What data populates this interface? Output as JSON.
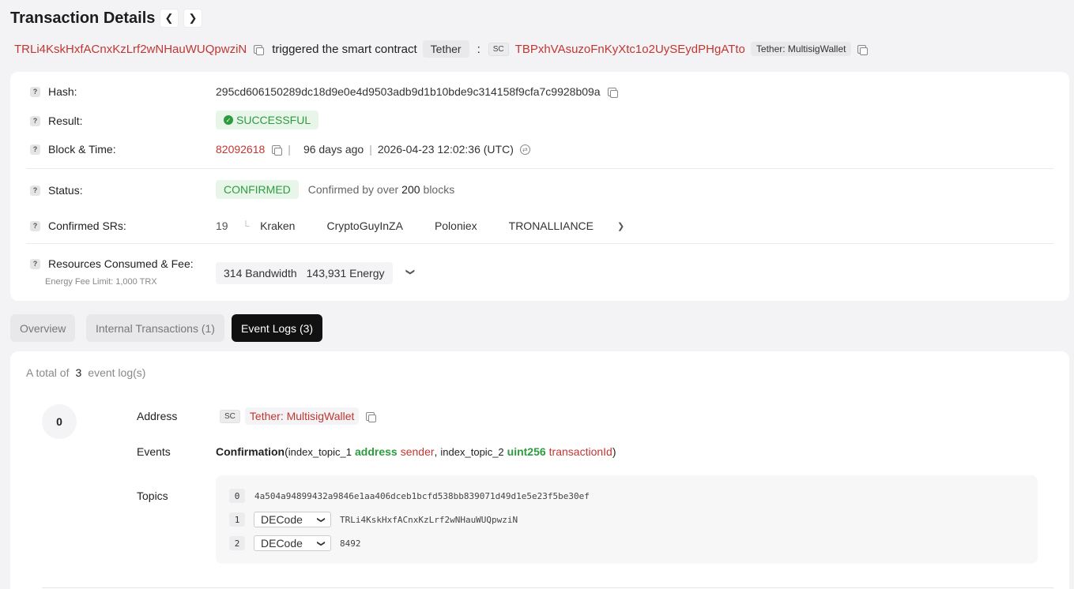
{
  "header": {
    "title": "Transaction Details",
    "prev_icon": "chevron-left-icon",
    "next_icon": "chevron-right-icon"
  },
  "summary": {
    "from_address": "TRLi4KskHxfACnxKzLrf2wNHauWUQpwziN",
    "action_text": "triggered the smart contract",
    "token_name": "Tether",
    "colon": ":",
    "sc_badge": "SC",
    "contract_address": "TBPxhVAsuzoFnKyXtc1o2UySEydPHgATto",
    "contract_tag": "Tether: MultisigWallet"
  },
  "details": {
    "question_mark": "?",
    "hash_label": "Hash:",
    "hash_value": "295cd606150289dc18d9e0e4d9503adb9d1b10bde9c314158f9cfa7c9928b09a",
    "result_label": "Result:",
    "result_value": "SUCCESSFUL",
    "block_label": "Block & Time:",
    "block_number": "82092618",
    "separator": "|",
    "age": "96 days ago",
    "timestamp": "2026-04-23 12:02:36 (UTC)",
    "status_label": "Status:",
    "status_value": "CONFIRMED",
    "confirmed_prefix": "Confirmed by over",
    "confirmed_count": "200",
    "confirmed_suffix": "blocks",
    "srs_label": "Confirmed SRs:",
    "srs_count": "19",
    "srs_list": [
      "Kraken",
      "CryptoGuyInZA",
      "Poloniex",
      "TRONALLIANCE"
    ],
    "resources_label": "Resources Consumed & Fee:",
    "energy_fee_limit": "Energy Fee Limit: 1,000 TRX",
    "bandwidth": "314 Bandwidth",
    "energy": "143,931 Energy"
  },
  "tabs": [
    {
      "label": "Overview",
      "active": false
    },
    {
      "label": "Internal Transactions (1)",
      "active": false
    },
    {
      "label": "Event Logs (3)",
      "active": true
    }
  ],
  "event_logs": {
    "total_prefix": "A total of",
    "total_count": "3",
    "total_suffix": "event log(s)",
    "log_index": "0",
    "address_label": "Address",
    "address_badge": "SC",
    "address_value": "Tether: MultisigWallet",
    "events_label": "Events",
    "event_name": "Confirmation",
    "paren_open": "(",
    "param1_name": "index_topic_1",
    "param1_type": "address",
    "param1_var": "sender",
    "comma": ",",
    "param2_name": "index_topic_2",
    "param2_type": "uint256",
    "param2_var": "transactionId",
    "paren_close": ")",
    "topics_label": "Topics",
    "topics": [
      {
        "index": "0",
        "value": "4a504a94899432a9846e1aa406dceb1bcfd538bb839071d49d1e5e23f5be30ef",
        "decode": ""
      },
      {
        "index": "1",
        "value": "TRLi4KskHxfACnxKzLrf2wNHauWUQpwziN",
        "decode": "DECode"
      },
      {
        "index": "2",
        "value": "8492",
        "decode": "DECode"
      }
    ]
  },
  "colors": {
    "accent_red": "#c23631",
    "success_green": "#2e9b3e",
    "active_tab": "#111111"
  }
}
